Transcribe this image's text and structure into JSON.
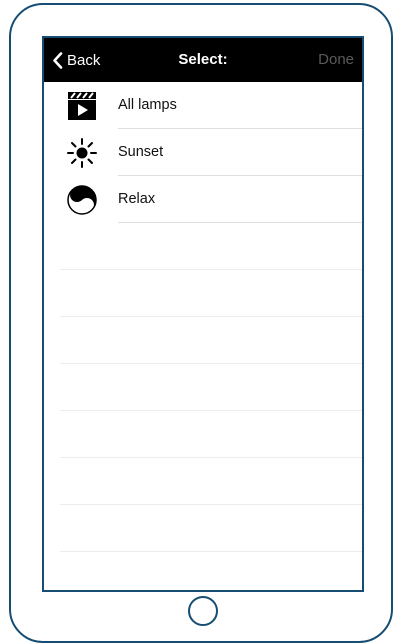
{
  "navbar": {
    "back_label": "Back",
    "title": "Select:",
    "done_label": "Done"
  },
  "scenes": [
    {
      "label": "All lamps",
      "icon": "clapperboard-icon"
    },
    {
      "label": "Sunset",
      "icon": "sun-icon"
    },
    {
      "label": "Relax",
      "icon": "yin-yang-icon"
    }
  ],
  "colors": {
    "device_frame": "#174d73",
    "navbar_bg": "#000000",
    "done_disabled": "#5a5a5a",
    "separator": "#dedede"
  }
}
